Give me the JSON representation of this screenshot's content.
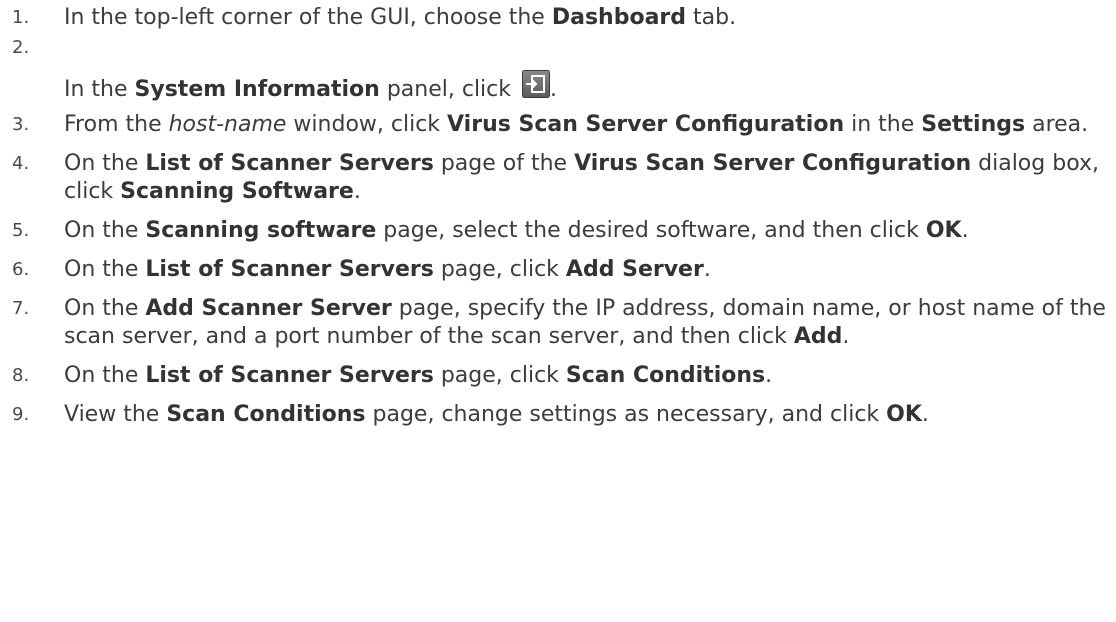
{
  "steps": [
    {
      "number": "1.",
      "parts": [
        {
          "t": "In the top-left corner of the GUI, choose the "
        },
        {
          "t": "Dashboard",
          "s": "b"
        },
        {
          "t": " tab."
        }
      ]
    },
    {
      "number": "2.",
      "parts": [
        {
          "t": "In the "
        },
        {
          "t": "System Information",
          "s": "b"
        },
        {
          "t": " panel, click "
        },
        {
          "icon": "settings-window-icon"
        },
        {
          "t": "."
        }
      ]
    },
    {
      "number": "3.",
      "parts": [
        {
          "t": "From the "
        },
        {
          "t": "host-name",
          "s": "i"
        },
        {
          "t": " window, click "
        },
        {
          "t": "Virus Scan Server Configuration",
          "s": "b"
        },
        {
          "t": " in the "
        },
        {
          "t": "Settings",
          "s": "b"
        },
        {
          "t": " area."
        }
      ]
    },
    {
      "number": "4.",
      "parts": [
        {
          "t": "On the "
        },
        {
          "t": "List of Scanner Servers",
          "s": "b"
        },
        {
          "t": " page of the "
        },
        {
          "t": "Virus Scan Server Configuration",
          "s": "b"
        },
        {
          "t": " dialog box, click "
        },
        {
          "t": "Scanning Software",
          "s": "b"
        },
        {
          "t": "."
        }
      ]
    },
    {
      "number": "5.",
      "parts": [
        {
          "t": "On the "
        },
        {
          "t": "Scanning software",
          "s": "b"
        },
        {
          "t": " page, select the desired software, and then click "
        },
        {
          "t": "OK",
          "s": "b"
        },
        {
          "t": "."
        }
      ]
    },
    {
      "number": "6.",
      "parts": [
        {
          "t": "On the "
        },
        {
          "t": "List of Scanner Servers",
          "s": "b"
        },
        {
          "t": " page, click "
        },
        {
          "t": "Add Server",
          "s": "b"
        },
        {
          "t": "."
        }
      ]
    },
    {
      "number": "7.",
      "parts": [
        {
          "t": "On the "
        },
        {
          "t": "Add Scanner Server",
          "s": "b"
        },
        {
          "t": " page, specify the IP address, domain name, or host name of the scan server, and a port number of the scan server, and then click "
        },
        {
          "t": "Add",
          "s": "b"
        },
        {
          "t": "."
        }
      ]
    },
    {
      "number": "8.",
      "parts": [
        {
          "t": "On the "
        },
        {
          "t": "List of Scanner Servers",
          "s": "b"
        },
        {
          "t": " page, click "
        },
        {
          "t": "Scan Conditions",
          "s": "b"
        },
        {
          "t": "."
        }
      ]
    },
    {
      "number": "9.",
      "parts": [
        {
          "t": "View the "
        },
        {
          "t": "Scan Conditions",
          "s": "b"
        },
        {
          "t": " page, change settings as necessary, and click "
        },
        {
          "t": "OK",
          "s": "b"
        },
        {
          "t": "."
        }
      ]
    }
  ]
}
